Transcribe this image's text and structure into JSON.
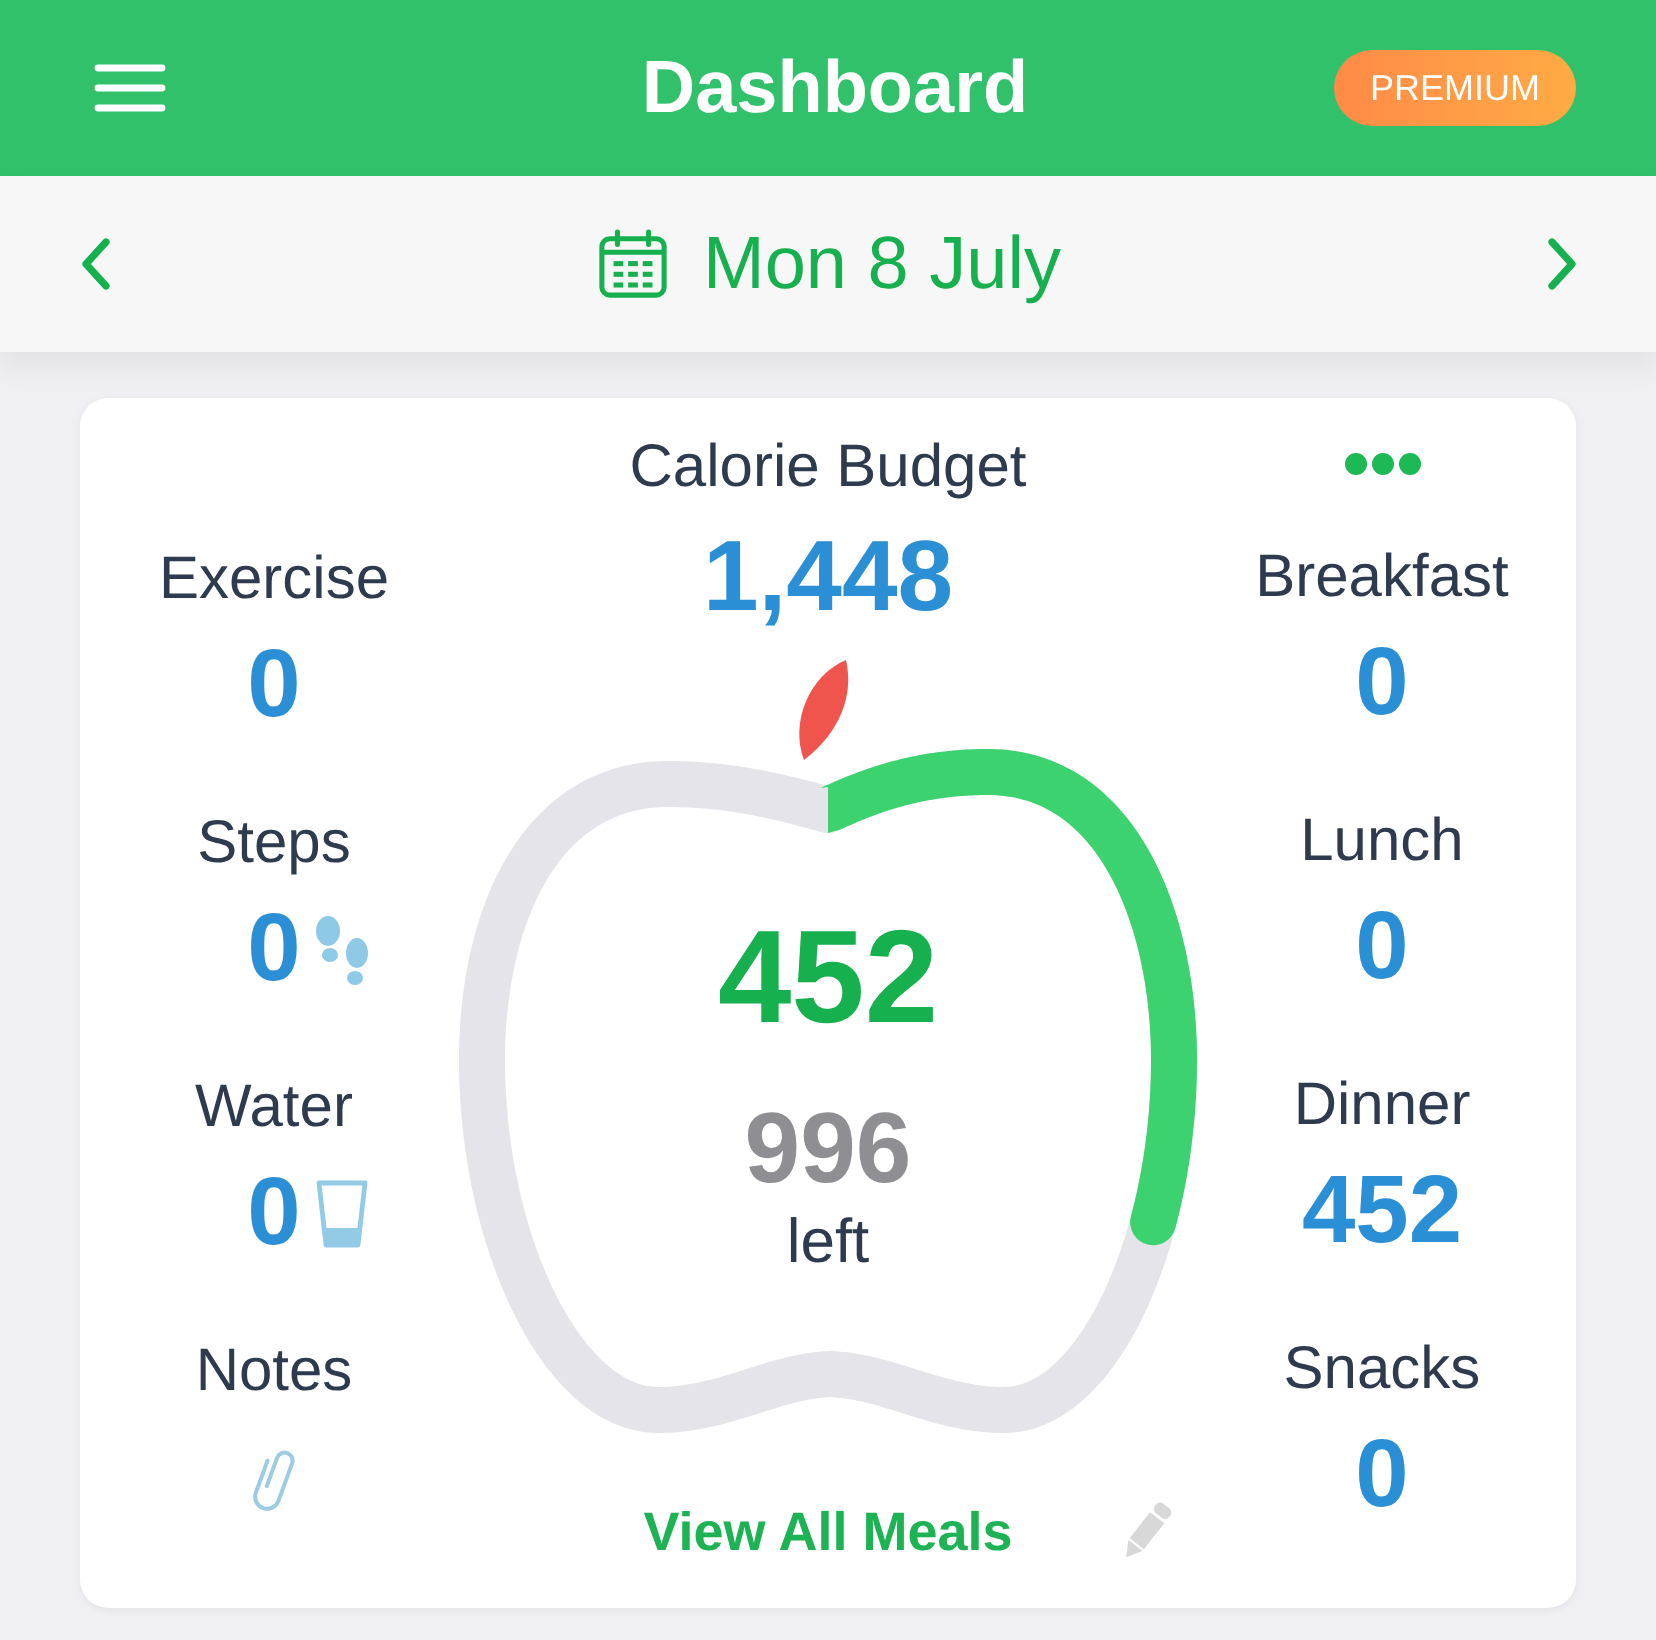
{
  "header": {
    "title": "Dashboard",
    "badge": "PREMIUM"
  },
  "date_bar": {
    "date": "Mon 8 July"
  },
  "summary": {
    "left_stats": [
      {
        "kind": "plain",
        "label": "Exercise",
        "value": "0"
      },
      {
        "kind": "steps",
        "label": "Steps",
        "value": "0"
      },
      {
        "kind": "water",
        "label": "Water",
        "value": "0"
      },
      {
        "kind": "notes",
        "label": "Notes"
      }
    ],
    "budget": {
      "label": "Calorie Budget",
      "value": "1,448"
    },
    "gauge": {
      "eaten": "452",
      "remaining": "996",
      "remaining_label": "left"
    },
    "meals": [
      {
        "label": "Breakfast",
        "value": "0"
      },
      {
        "label": "Lunch",
        "value": "0"
      },
      {
        "label": "Dinner",
        "value": "452"
      },
      {
        "label": "Snacks",
        "value": "0"
      }
    ],
    "link": "View All Meals"
  }
}
